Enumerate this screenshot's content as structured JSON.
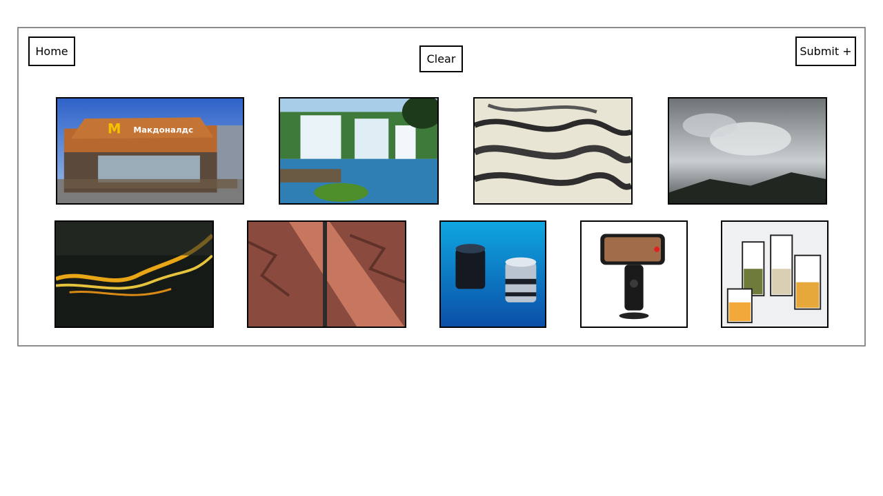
{
  "toolbar": {
    "home_label": "Home",
    "clear_label": "Clear",
    "submit_label": "Submit +"
  },
  "gallery": {
    "images": [
      {
        "name": "mcdonalds-restaurant-image",
        "sign_text": "Макдоналдс"
      },
      {
        "name": "waterfall-image"
      },
      {
        "name": "braided-river-aerial-image"
      },
      {
        "name": "cloudy-sky-mountains-image"
      },
      {
        "name": "glowing-river-delta-image"
      },
      {
        "name": "red-desert-canyon-image"
      },
      {
        "name": "metal-cylinders-blue-image"
      },
      {
        "name": "phone-gimbal-tracker-image"
      },
      {
        "name": "food-storage-containers-image"
      }
    ]
  }
}
